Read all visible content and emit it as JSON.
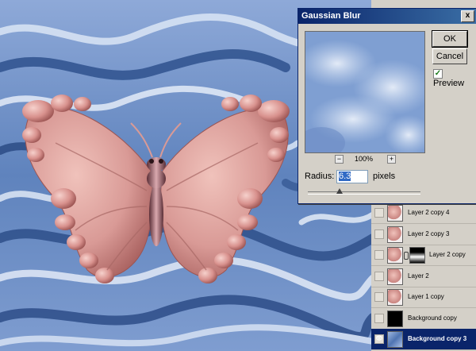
{
  "dialog": {
    "title": "Gaussian Blur",
    "close_glyph": "x",
    "ok_label": "OK",
    "cancel_label": "Cancel",
    "preview_label": "Preview",
    "preview_checked": true,
    "zoom_out_glyph": "−",
    "zoom_in_glyph": "+",
    "zoom_level": "100%",
    "radius_label": "Radius:",
    "radius_value": "6.3",
    "radius_unit": "pixels",
    "slider_fraction": 0.28
  },
  "layers": [
    {
      "name": "Layer 2 copy 4",
      "thumb": "butterfly",
      "visible": false,
      "selected": false
    },
    {
      "name": "Layer 2 copy 3",
      "thumb": "butterfly",
      "visible": false,
      "selected": false
    },
    {
      "name": "Layer 2 copy",
      "thumb": "butterfly-mask",
      "visible": false,
      "selected": false
    },
    {
      "name": "Layer 2",
      "thumb": "butterfly",
      "visible": false,
      "selected": false
    },
    {
      "name": "Layer 1 copy",
      "thumb": "butterfly",
      "visible": false,
      "selected": false
    },
    {
      "name": "Background copy",
      "thumb": "black",
      "visible": false,
      "selected": false
    },
    {
      "name": "Background copy 3",
      "thumb": "clouds",
      "visible": true,
      "selected": true
    }
  ],
  "colors": {
    "sky_dark": "#3a5d98",
    "sky_light": "#c9d8ef",
    "butterfly_skin": "#d99a96",
    "dialog_title": "#0a246a",
    "selected_row": "#0a246a"
  }
}
